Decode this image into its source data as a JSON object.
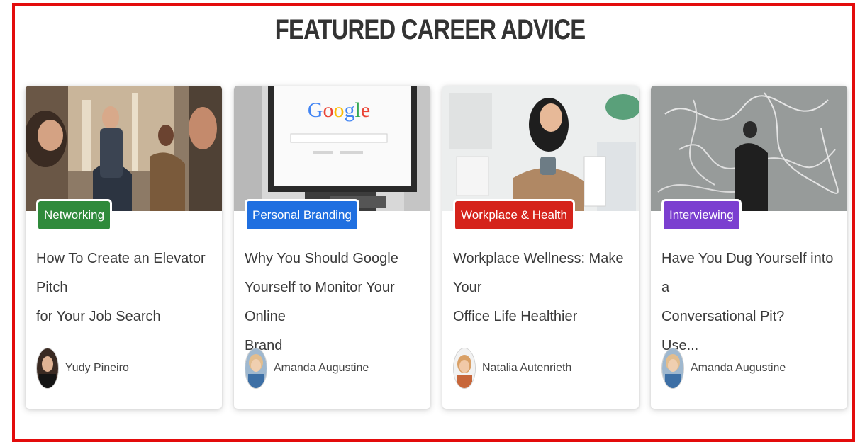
{
  "section": {
    "title": "FEATURED CAREER ADVICE"
  },
  "colors": {
    "frame": "#e30c0c",
    "networking": "#2f8a3b",
    "personal_branding": "#1f6fe0",
    "workplace_health": "#d5231b",
    "interviewing": "#7b3fd0"
  },
  "cards": [
    {
      "category": "Networking",
      "title": "How To Create an Elevator Pitch\nfor Your Job Search",
      "author": "Yudy Pineiro",
      "image": "networking-photo"
    },
    {
      "category": "Personal Branding",
      "title": "Why You Should Google\nYourself to Monitor Your Online\nBrand",
      "author": "Amanda Augustine",
      "image": "google-search-photo",
      "image_text": "Google"
    },
    {
      "category": "Workplace & Health",
      "title": "Workplace Wellness: Make Your\nOffice Life Healthier",
      "author": "Natalia Autenrieth",
      "image": "office-worker-photo"
    },
    {
      "category": "Interviewing",
      "title": "Have You Dug Yourself into a\nConversational Pit?\nUse...",
      "author": "Amanda Augustine",
      "image": "tangled-lines-photo"
    }
  ]
}
